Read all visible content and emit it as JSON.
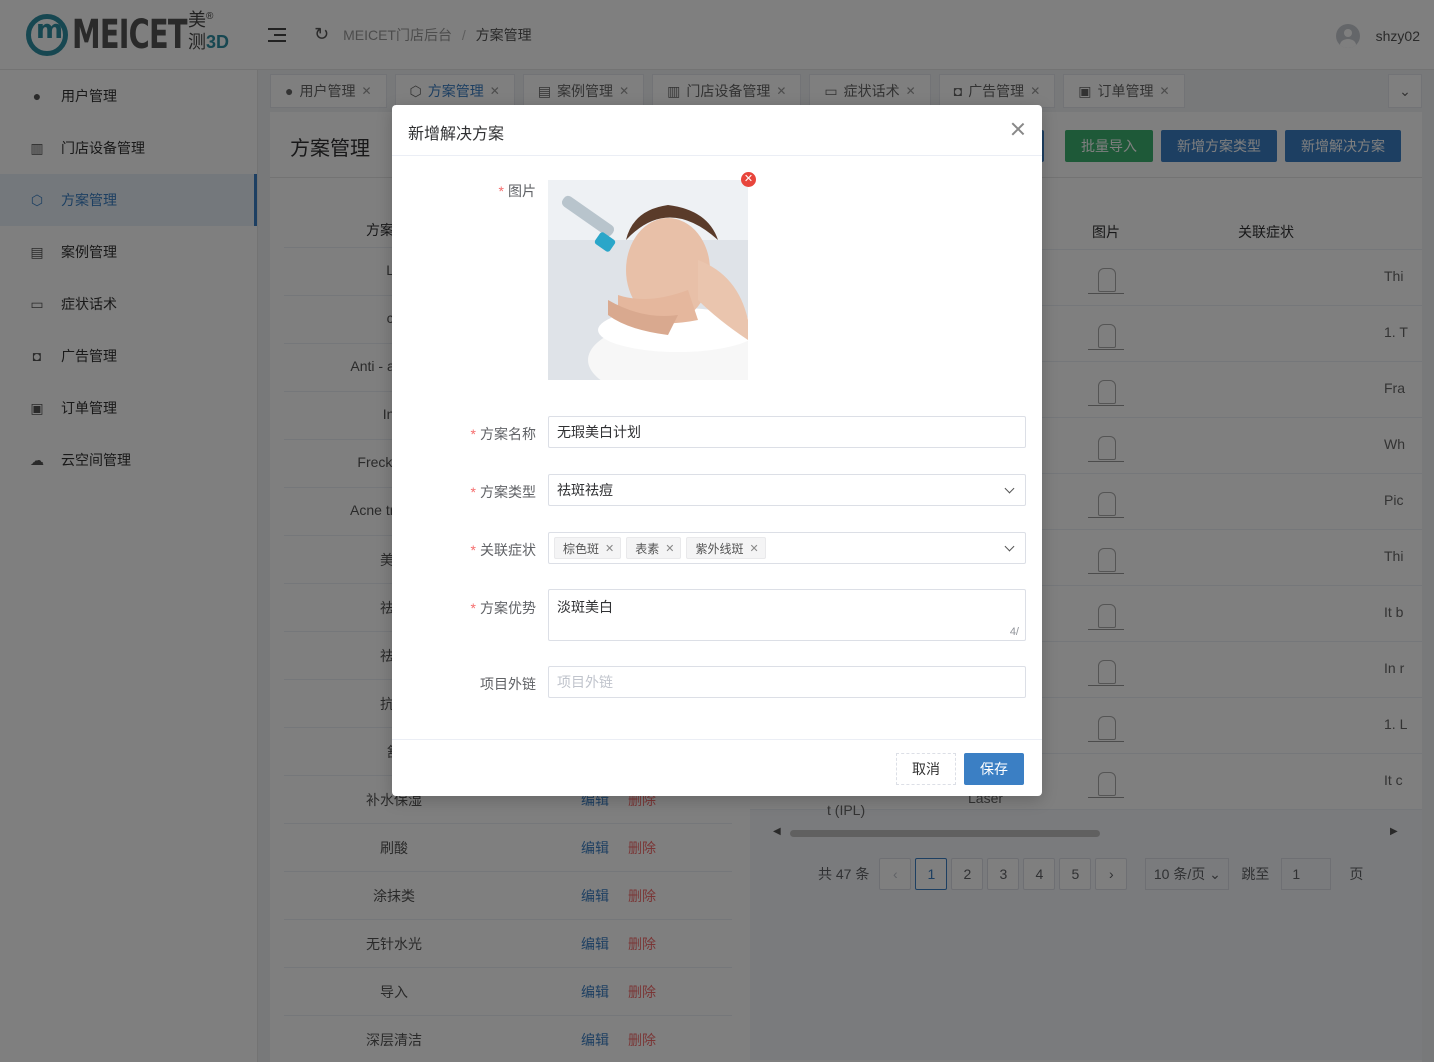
{
  "header": {
    "logo_text": "MEICET",
    "logo_sub_top": "美",
    "logo_sub_bottom": "测",
    "logo_sub_3d": "3D",
    "breadcrumb_root": "MEICET门店后台",
    "breadcrumb_sep": "/",
    "breadcrumb_current": "方案管理",
    "username": "shzy02"
  },
  "sidebar": {
    "items": [
      {
        "label": "用户管理",
        "icon": "user-icon"
      },
      {
        "label": "门店设备管理",
        "icon": "device-icon"
      },
      {
        "label": "方案管理",
        "icon": "plan-icon"
      },
      {
        "label": "案例管理",
        "icon": "case-icon"
      },
      {
        "label": "症状话术",
        "icon": "chat-icon"
      },
      {
        "label": "广告管理",
        "icon": "ad-icon"
      },
      {
        "label": "订单管理",
        "icon": "order-icon"
      },
      {
        "label": "云空间管理",
        "icon": "cloud-icon"
      }
    ]
  },
  "tabs": [
    {
      "label": "用户管理"
    },
    {
      "label": "方案管理"
    },
    {
      "label": "案例管理"
    },
    {
      "label": "门店设备管理"
    },
    {
      "label": "症状话术"
    },
    {
      "label": "广告管理"
    },
    {
      "label": "订单管理"
    }
  ],
  "page": {
    "title": "方案管理",
    "batch_import": "批量导入",
    "new_type": "新增方案类型",
    "new_solution": "新增解决方案"
  },
  "left_table": {
    "header": "方案",
    "rows": [
      {
        "name": "La"
      },
      {
        "name": "ce"
      },
      {
        "name": "Anti - aging ar"
      },
      {
        "name": "Inje"
      },
      {
        "name": "Freckle and"
      },
      {
        "name": "Acne treatmer"
      },
      {
        "name": "美白"
      },
      {
        "name": "祛斑"
      },
      {
        "name": "祛痘"
      },
      {
        "name": "抗衰"
      },
      {
        "name": "舒"
      },
      {
        "name": "补水保湿"
      },
      {
        "name": "刷酸"
      },
      {
        "name": "涂抹类"
      },
      {
        "name": "无针水光"
      },
      {
        "name": "导入"
      },
      {
        "name": "深层清洁"
      }
    ],
    "edit_label": "编辑",
    "delete_label": "删除"
  },
  "right_table": {
    "col_image": "图片",
    "col_symptom": "关联症状",
    "symptoms": [
      "Thi",
      "1. T",
      "Fra",
      "Wh",
      "Pic",
      "Thi",
      "It b",
      "In r",
      "1. L",
      "It c"
    ],
    "partial_text_1": "t (IPL)",
    "partial_text_2": "Laser"
  },
  "pagination": {
    "total": "共 47 条",
    "pages": [
      "1",
      "2",
      "3",
      "4",
      "5"
    ],
    "page_size": "10 条/页",
    "jump_label": "跳至",
    "jump_value": "1",
    "page_unit": "页"
  },
  "modal": {
    "title": "新增解决方案",
    "image_label": "图片",
    "name_label": "方案名称",
    "name_value": "无瑕美白计划",
    "type_label": "方案类型",
    "type_value": "祛斑祛痘",
    "symptom_label": "关联症状",
    "symptom_tags": [
      "棕色斑",
      "表素",
      "紫外线斑"
    ],
    "advantage_label": "方案优势",
    "advantage_value": "淡斑美白",
    "advantage_counter": "4/",
    "link_label": "项目外链",
    "link_placeholder": "项目外链",
    "cancel_label": "取消",
    "save_label": "保存"
  },
  "colors": {
    "primary": "#3b7fc4",
    "success": "#3cb371",
    "danger": "#f56c6c"
  }
}
